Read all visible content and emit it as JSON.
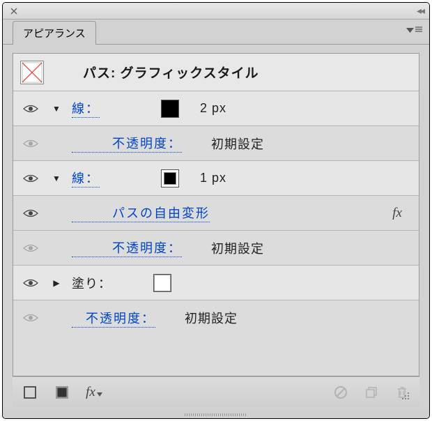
{
  "panel": {
    "tab_label": "アピアランス",
    "title_prefix": "パス:",
    "title_value": "グラフィックスタイル"
  },
  "rows": {
    "stroke1": {
      "label": "線：",
      "width": "2 px"
    },
    "opacity1": {
      "label": "不透明度：",
      "value": "初期設定"
    },
    "stroke2": {
      "label": "線：",
      "width": "1 px"
    },
    "effect": {
      "label": "パスの自由変形"
    },
    "opacity2": {
      "label": "不透明度：",
      "value": "初期設定"
    },
    "fill": {
      "label": "塗り："
    },
    "opacity3": {
      "label": "不透明度：",
      "value": "初期設定"
    }
  },
  "footer": {
    "fx_label": "fx"
  }
}
